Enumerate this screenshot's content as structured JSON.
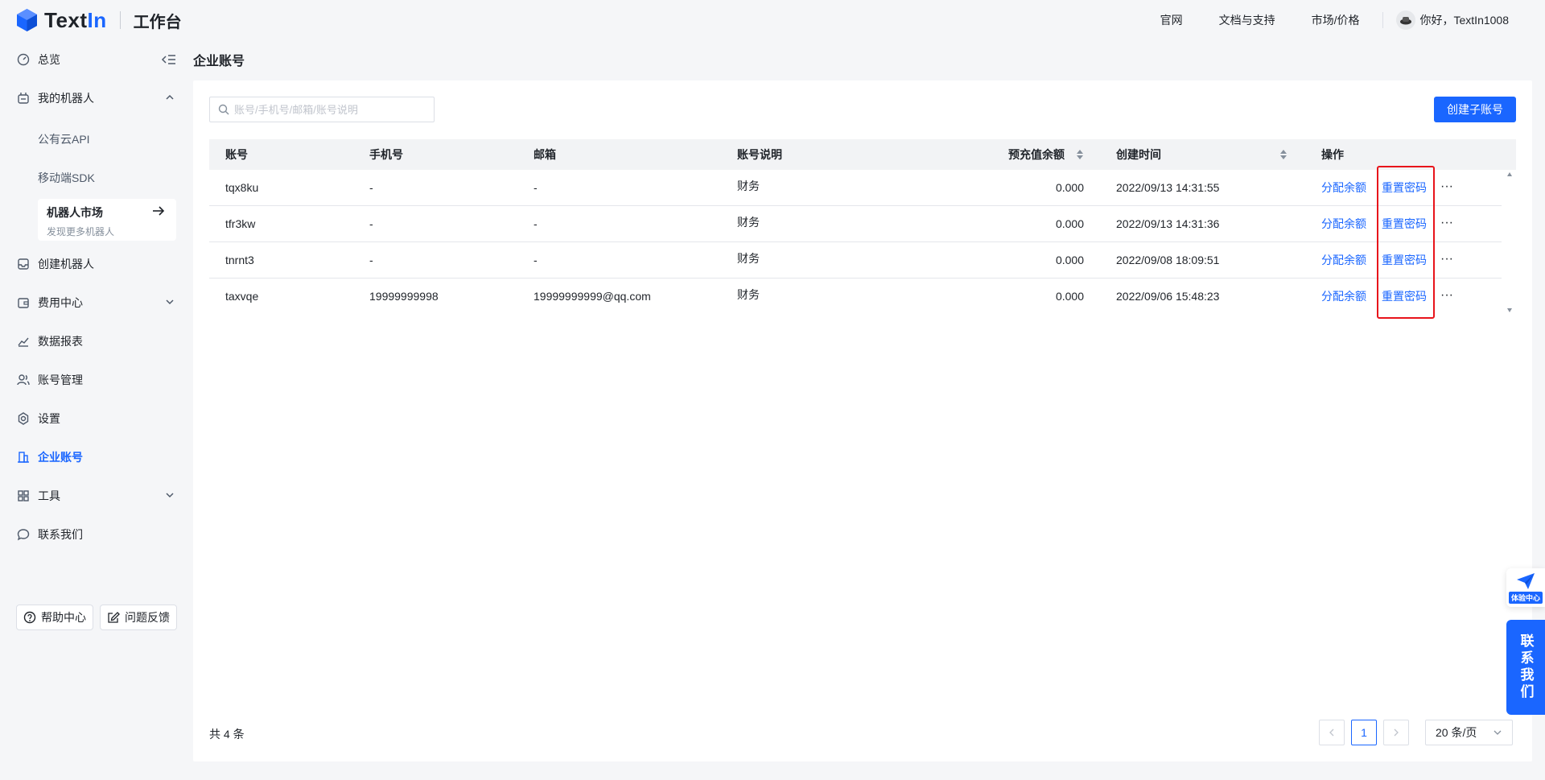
{
  "header": {
    "brand_prefix": "Text",
    "brand_suffix": "In",
    "workspace": "工作台",
    "nav": [
      "官网",
      "文档与支持",
      "市场/价格"
    ],
    "greeting": "你好，TextIn1008"
  },
  "sidebar": {
    "overview": "总览",
    "my_robots": "我的机器人",
    "sub_items": [
      "公有云API",
      "移动端SDK"
    ],
    "market": {
      "title": "机器人市场",
      "subtitle": "发现更多机器人"
    },
    "create_robot": "创建机器人",
    "billing": "费用中心",
    "reports": "数据报表",
    "account_mgmt": "账号管理",
    "settings": "设置",
    "enterprise": "企业账号",
    "tools": "工具",
    "contact": "联系我们",
    "help_center": "帮助中心",
    "feedback": "问题反馈"
  },
  "page": {
    "title": "企业账号",
    "search_placeholder": "账号/手机号/邮箱/账号说明",
    "create_button": "创建子账号"
  },
  "table": {
    "columns": [
      "账号",
      "手机号",
      "邮箱",
      "账号说明",
      "预充值余额",
      "创建时间",
      "操作"
    ],
    "action_labels": {
      "allocate": "分配余额",
      "reset": "重置密码",
      "more": "···"
    },
    "rows": [
      {
        "account": "tqx8ku",
        "phone": "-",
        "email": "-",
        "desc": "财务",
        "balance": "0.000",
        "created": "2022/09/13 14:31:55"
      },
      {
        "account": "tfr3kw",
        "phone": "-",
        "email": "-",
        "desc": "财务",
        "balance": "0.000",
        "created": "2022/09/13 14:31:36"
      },
      {
        "account": "tnrnt3",
        "phone": "-",
        "email": "-",
        "desc": "财务",
        "balance": "0.000",
        "created": "2022/09/08 18:09:51"
      },
      {
        "account": "taxvqe",
        "phone": "19999999998",
        "email": "19999999999@qq.com",
        "desc": "财务",
        "balance": "0.000",
        "created": "2022/09/06 15:48:23"
      }
    ]
  },
  "pagination": {
    "total_text": "共 4 条",
    "current_page": "1",
    "page_size": "20 条/页"
  },
  "float": {
    "experience": "体验中心",
    "contact": "联系我们"
  },
  "colors": {
    "accent": "#1a66ff",
    "highlight": "#e8141b"
  }
}
